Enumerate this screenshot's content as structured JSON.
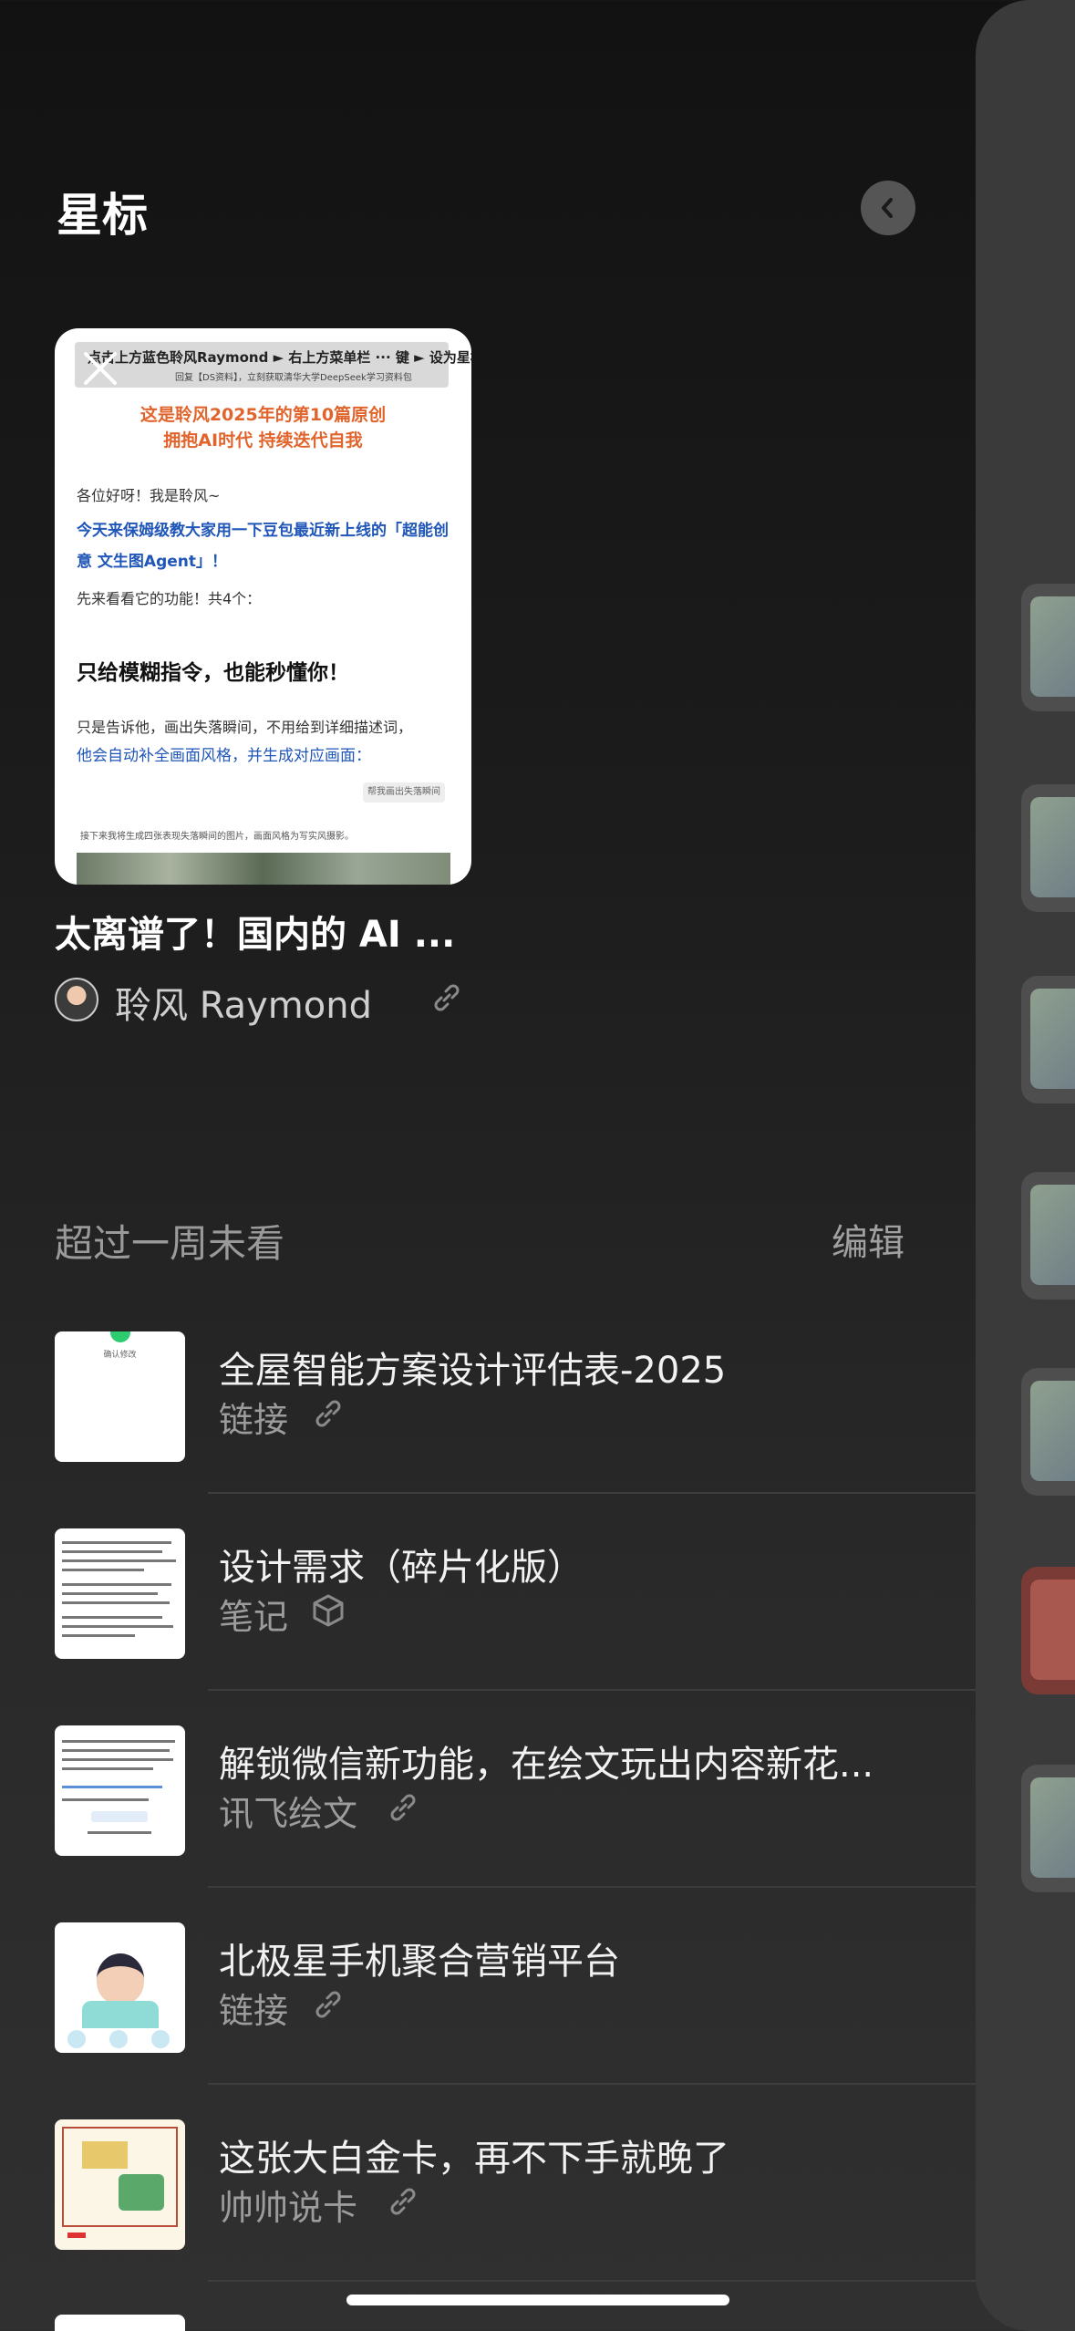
{
  "header": {
    "title": "星标"
  },
  "featured": {
    "preview": {
      "banner_line1": "点击上方蓝色聆风Raymond ► 右上方菜单栏 ··· 键 ► 设为星标 ★",
      "banner_line2": "回复【DS资料】，立刻获取清华大学DeepSeek学习资料包",
      "headline1": "这是聆风2025年的第10篇原创",
      "headline2": "拥抱AI时代 持续迭代自我",
      "greeting": "各位好呀！我是聆风~",
      "blue_intro": "今天来保姆级教大家用一下豆包最近新上线的「超能创意 文生图Agent」！",
      "features_line": "先来看看它的功能！共4个：",
      "bold_heading": "只给模糊指令，也能秒懂你！",
      "body_line": "只是告诉他，画出失落瞬间，不用给到详细描述词，",
      "blue_line": "他会自动补全画面风格，并生成对应画面：",
      "tag": "帮我画出失落瞬间",
      "small_note": "接下来我将生成四张表现失落瞬间的图片，画面风格为写实风摄影。"
    },
    "title": "太离谱了！国内的 AI ...",
    "author": "聆风 Raymond"
  },
  "section": {
    "title": "超过一周未看",
    "edit_label": "编辑"
  },
  "items": [
    {
      "title": "全屋智能方案设计评估表-2025",
      "subtitle": "链接",
      "icon": "link-icon"
    },
    {
      "title": "设计需求（碎片化版）",
      "subtitle": "笔记",
      "icon": "cube-icon"
    },
    {
      "title": "解锁微信新功能，在绘文玩出内容新花...",
      "subtitle": "讯飞绘文",
      "icon": "link-icon"
    },
    {
      "title": "北极星手机聚合营销平台",
      "subtitle": "链接",
      "icon": "link-icon"
    },
    {
      "title": "这张大白金卡，再不下手就晚了",
      "subtitle": "帅帅说卡",
      "icon": "link-icon"
    }
  ],
  "thumbs": {
    "first_label": "确认修改"
  }
}
